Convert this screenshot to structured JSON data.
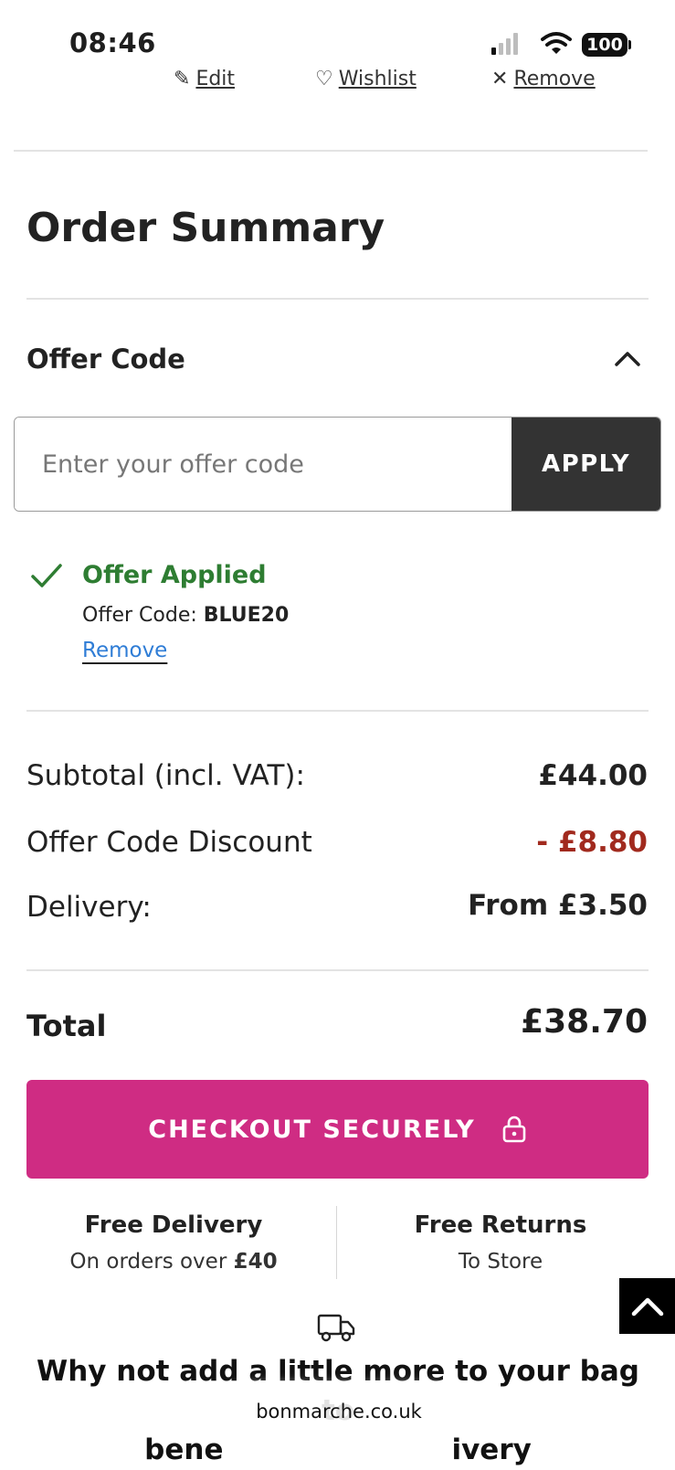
{
  "status_bar": {
    "time": "08:46",
    "battery": "100"
  },
  "item_actions": {
    "edit": "Edit",
    "wishlist": "Wishlist",
    "remove": "Remove"
  },
  "order_summary": {
    "title": "Order Summary",
    "offer_code": {
      "label": "Offer Code",
      "placeholder": "Enter your offer code",
      "apply_label": "APPLY",
      "applied_title": "Offer Applied",
      "applied_code_label": "Offer Code:",
      "applied_code": "BLUE20",
      "remove_label": "Remove"
    },
    "rows": [
      {
        "label": "Subtotal (incl. VAT):",
        "value": "£44.00"
      },
      {
        "label": "Offer Code Discount",
        "value": "- £8.80"
      },
      {
        "label": "Delivery:",
        "value": "From £3.50"
      }
    ],
    "total_label": "Total",
    "total_value": "£38.70",
    "checkout_label": "CHECKOUT SECURELY"
  },
  "perks": [
    {
      "title": "Free Delivery",
      "sub_prefix": "On orders over",
      "sub_bold": "£40"
    },
    {
      "title": "Free Returns",
      "sub": "To Store"
    }
  ],
  "promo": {
    "line1": "Why not add a little more to your bag to",
    "line2_start": "bene",
    "line2_end": "ivery"
  },
  "browser": {
    "url": "bonmarche.co.uk"
  },
  "colors": {
    "accent": "#cf2c83",
    "success": "#2e7d32",
    "discount": "#a12a1e",
    "link": "#2f7dd6"
  }
}
